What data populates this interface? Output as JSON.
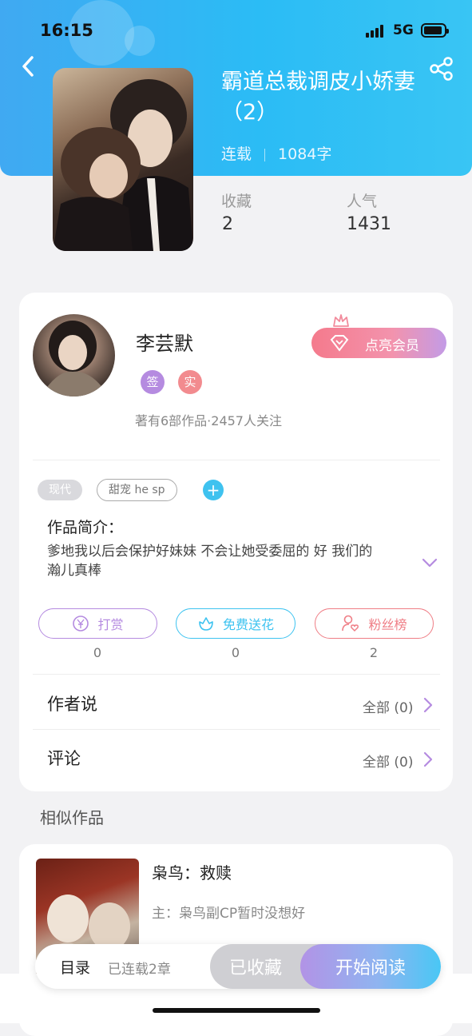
{
  "status": {
    "time": "16:15",
    "network": "5G"
  },
  "book": {
    "title": "霸道总裁调皮小娇妻（2）",
    "status": "连载",
    "word_count": "1084字",
    "favorites_label": "收藏",
    "favorites_value": "2",
    "popularity_label": "人气",
    "popularity_value": "1431"
  },
  "author": {
    "name": "李芸默",
    "badge_sign": "签",
    "badge_real": "实",
    "info": "著有6部作品·2457人关注",
    "member_button": "点亮会员"
  },
  "tags": [
    "现代",
    "甜宠 he sp"
  ],
  "tag_add": "+",
  "intro": {
    "title": "作品简介：",
    "text": "爹地我以后会保护好妹妹 不会让她受委屈的 好 我们的瀚儿真棒"
  },
  "actions": [
    {
      "label": "打赏",
      "count": "0",
      "color": "#b58be0"
    },
    {
      "label": "免费送花",
      "count": "0",
      "color": "#3ec3f0"
    },
    {
      "label": "粉丝榜",
      "count": "2",
      "color": "#ef7e86"
    }
  ],
  "rows": [
    {
      "title": "作者说",
      "more": "全部 (0)"
    },
    {
      "title": "评论",
      "more": "全部 (0)"
    }
  ],
  "similar": {
    "section_label": "相似作品",
    "title": "枭鸟：救赎",
    "subtitle": "主：枭鸟副CP暂时没想好"
  },
  "bottom": {
    "toc_label": "目录",
    "toc_count": "已连载2章",
    "collected_label": "已收藏",
    "read_label": "开始阅读"
  },
  "colors": {
    "header_blue": "#2bbcf5",
    "purple": "#b58be0",
    "cyan": "#3ec3f0",
    "pink": "#ef7e86"
  }
}
